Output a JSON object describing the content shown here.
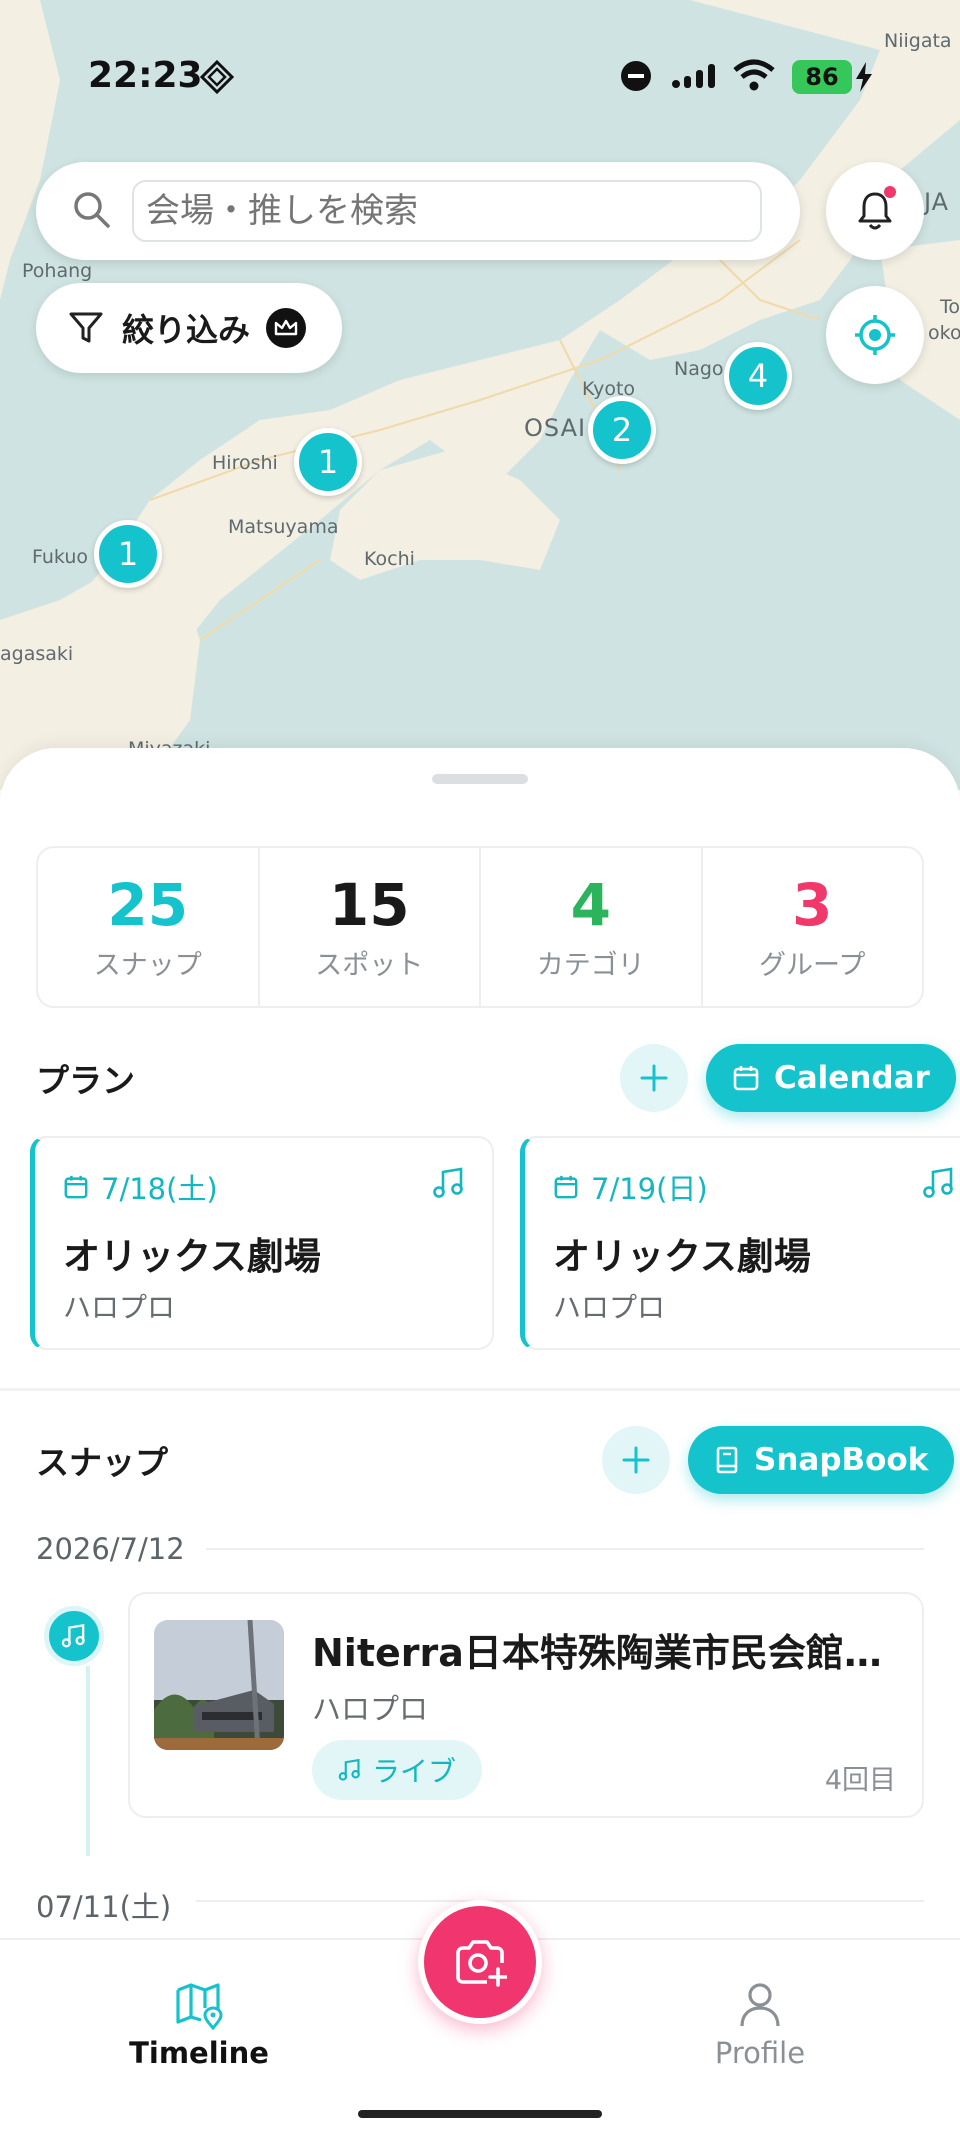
{
  "status_bar": {
    "time": "22:23",
    "battery": "86"
  },
  "map": {
    "labels": [
      "Niigata",
      "JA",
      "Pohang",
      "Kyoto",
      "Nago",
      "OSAI",
      "Hiroshi",
      "Matsuyama",
      "Kochi",
      "Fukuo",
      "agasaki",
      "To",
      "okol",
      "Miyazaki"
    ],
    "clusters": [
      "1",
      "1",
      "2",
      "4"
    ]
  },
  "search": {
    "placeholder": "会場・推しを検索"
  },
  "filter": {
    "label": "絞り込み"
  },
  "stats": [
    {
      "value": "25",
      "label": "スナップ",
      "color": "#14c3cc"
    },
    {
      "value": "15",
      "label": "スポット",
      "color": "#1a1a1a"
    },
    {
      "value": "4",
      "label": "カテゴリ",
      "color": "#2cb45d"
    },
    {
      "value": "3",
      "label": "グループ",
      "color": "#f0386b"
    }
  ],
  "plans": {
    "title": "プラン",
    "calendar_label": "Calendar",
    "cards": [
      {
        "date": "7/18(土)",
        "venue": "オリックス劇場",
        "artist": "ハロプロ"
      },
      {
        "date": "7/19(日)",
        "venue": "オリックス劇場",
        "artist": "ハロプロ"
      }
    ]
  },
  "snaps": {
    "title": "スナップ",
    "snapbook_label": "SnapBook",
    "groups": [
      {
        "date": "2026/7/12",
        "items": [
          {
            "title": "Niterra日本特殊陶業市民会館…",
            "artist": "ハロプロ",
            "tag": "ライブ",
            "count": "4回目"
          }
        ]
      },
      {
        "date": "07/11(土)",
        "items": []
      }
    ]
  },
  "tabbar": {
    "timeline": "Timeline",
    "profile": "Profile"
  },
  "colors": {
    "accent": "#14c3cc",
    "pink": "#f1356f",
    "green": "#2cb45d"
  },
  "icons": [
    "search-icon",
    "bell-icon",
    "locate-icon",
    "filter-icon",
    "crown-icon",
    "plus-icon",
    "calendar-icon",
    "music-icon",
    "book-icon",
    "camera-add-icon",
    "map-icon",
    "person-icon"
  ]
}
